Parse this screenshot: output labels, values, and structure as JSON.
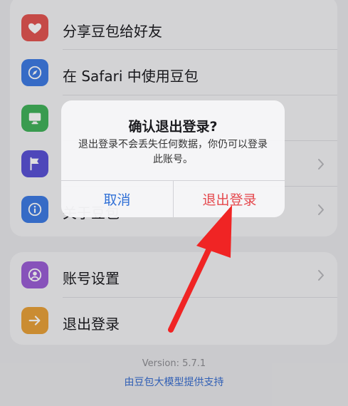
{
  "settings": {
    "group1": [
      {
        "label": "分享豆包给好友",
        "icon": "heart-icon",
        "color": "#e35552",
        "chevron": false
      },
      {
        "label": "在 Safari 中使用豆包",
        "icon": "compass-icon",
        "color": "#3f7be4",
        "chevron": false
      },
      {
        "label": "",
        "icon": "monitor-icon",
        "color": "#42b25b",
        "chevron": false
      },
      {
        "label": "",
        "icon": "flag-icon",
        "color": "#5a52d6",
        "chevron": true
      },
      {
        "label": "关于豆包",
        "icon": "info-icon",
        "color": "#3f7be4",
        "chevron": true
      }
    ],
    "group2": [
      {
        "label": "账号设置",
        "icon": "person-circle-icon",
        "color": "#9b5fd6",
        "chevron": true
      },
      {
        "label": "退出登录",
        "icon": "arrow-right-icon",
        "color": "#e8a13a",
        "chevron": false
      }
    ]
  },
  "footer": {
    "version": "Version: 5.7.1",
    "powered_by": "由豆包大模型提供支持"
  },
  "dialog": {
    "title": "确认退出登录?",
    "message": "退出登录不会丢失任何数据，你仍可以登录此账号。",
    "cancel_label": "取消",
    "confirm_label": "退出登录",
    "cancel_color": "#2f6fd6",
    "confirm_color": "#e5484d"
  },
  "annotation": {
    "arrow_color": "#f02424"
  }
}
